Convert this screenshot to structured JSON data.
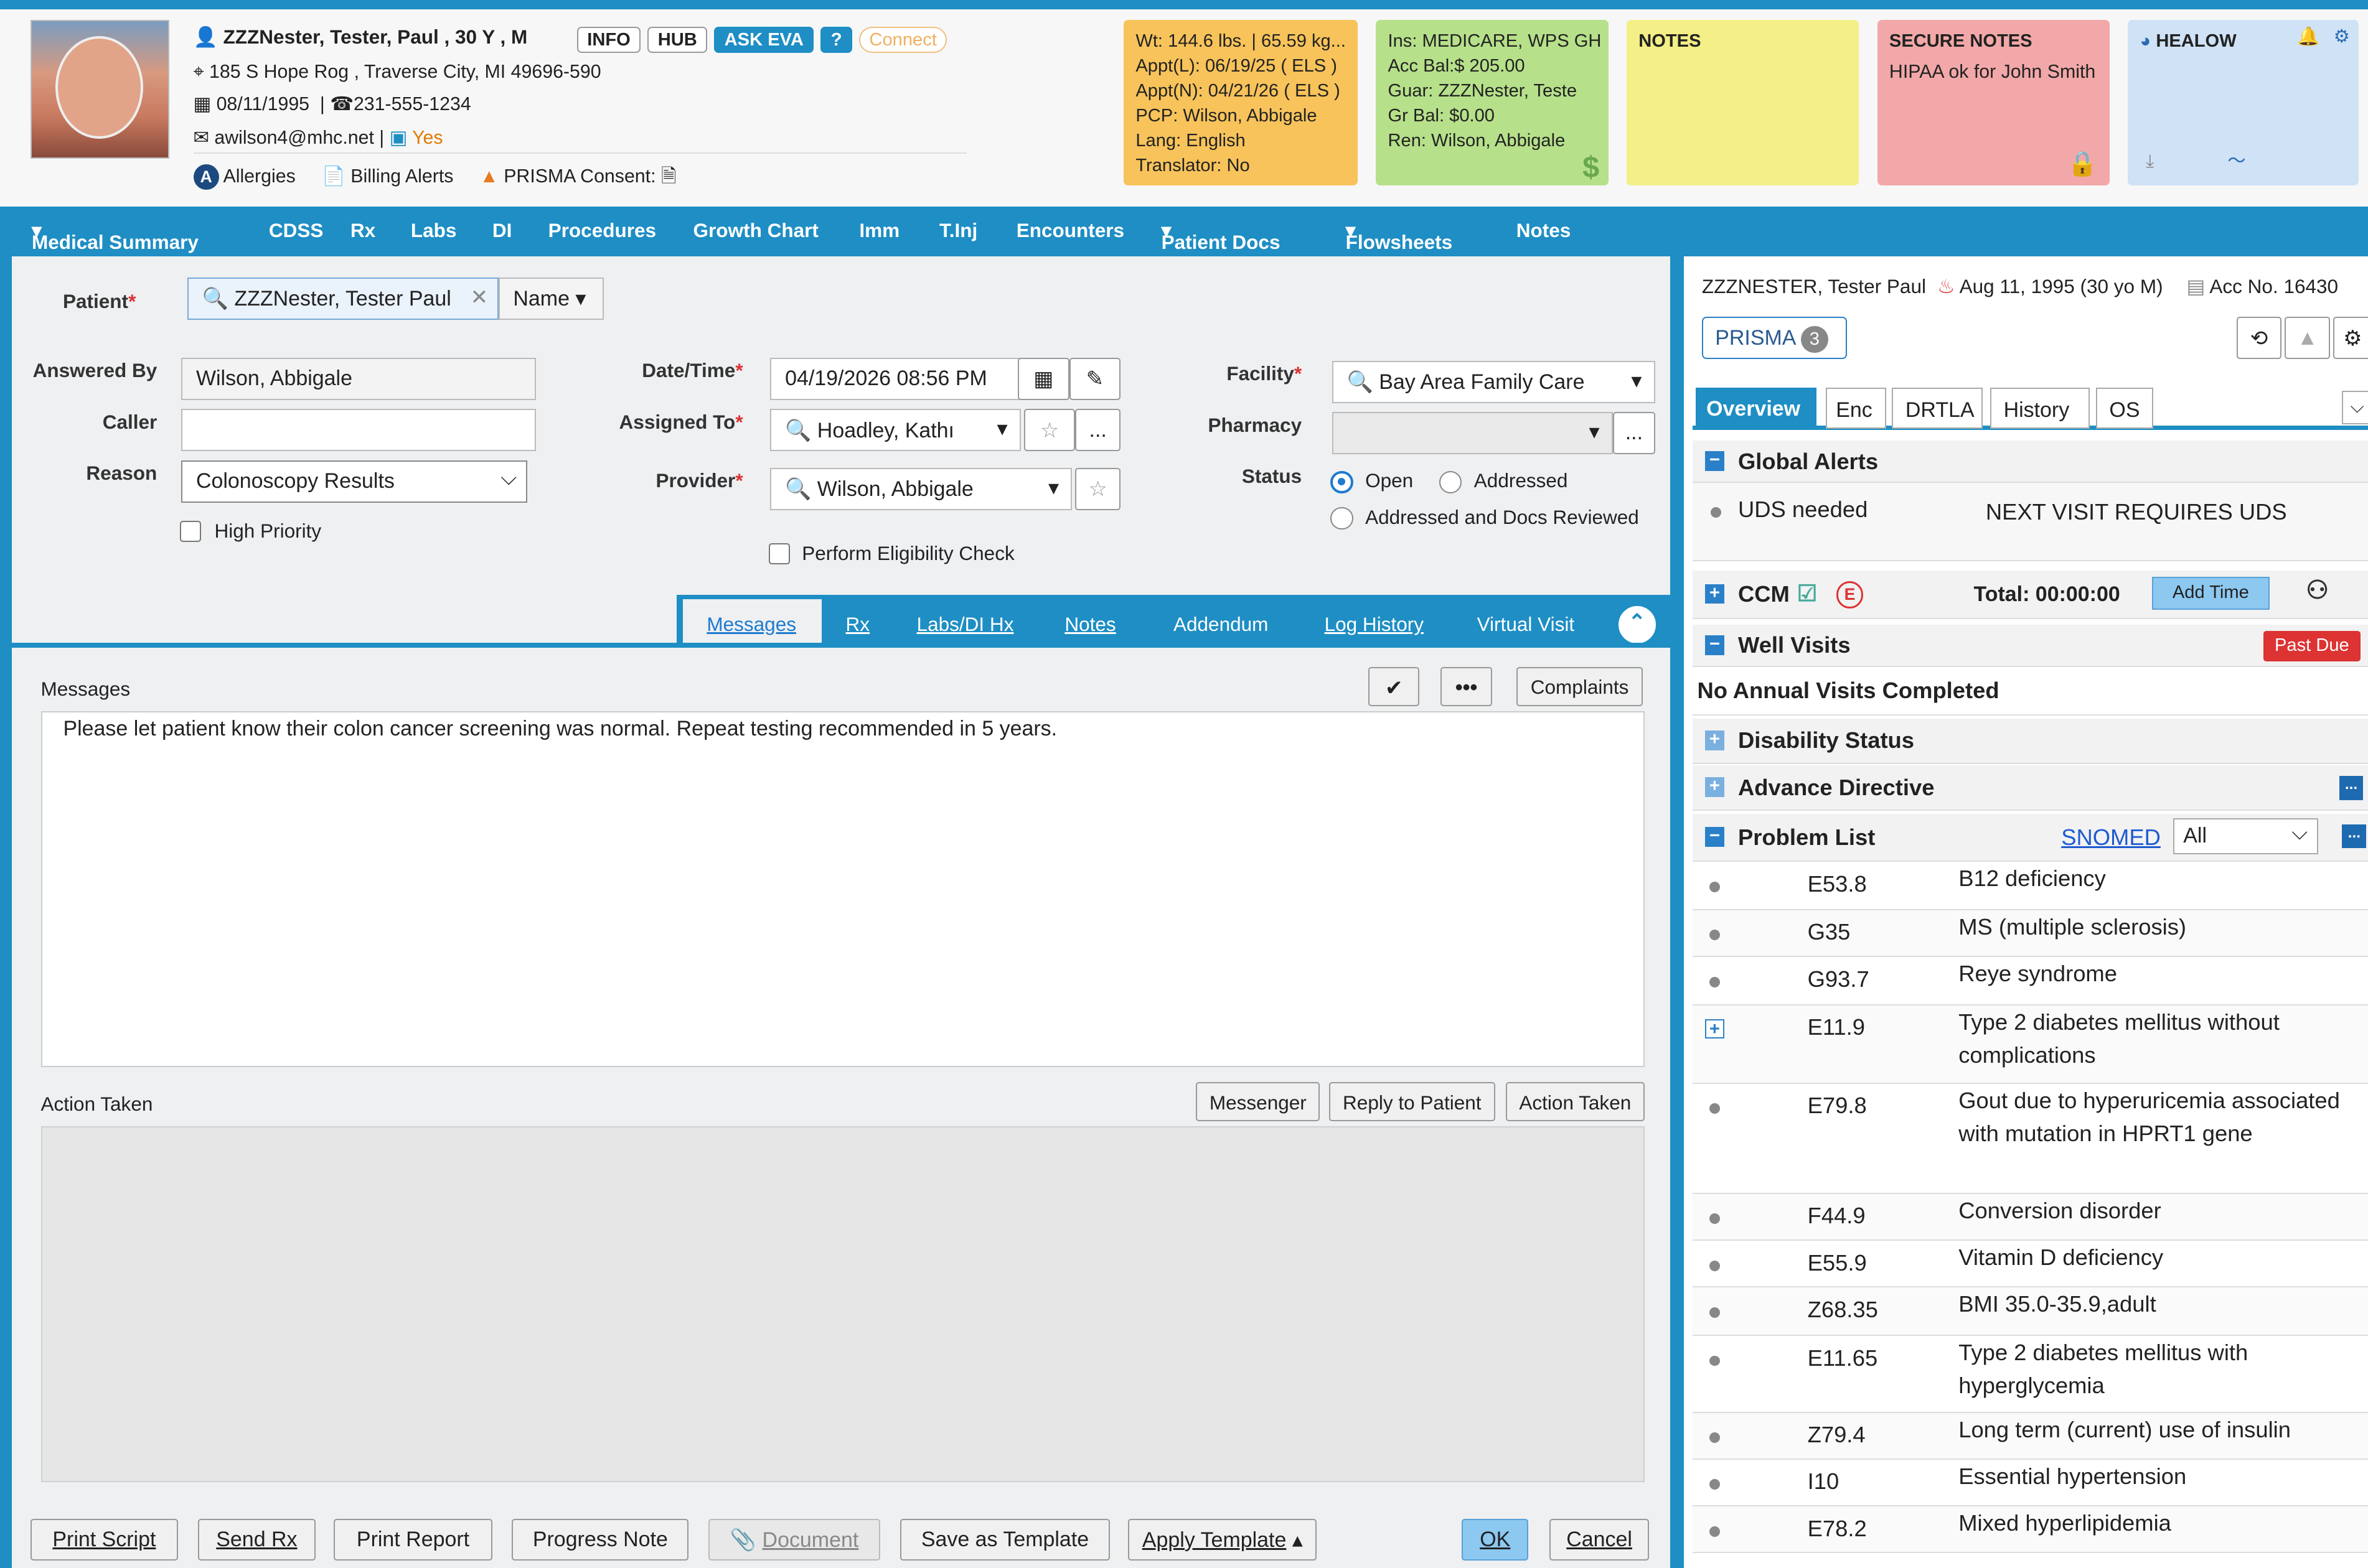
{
  "patient": {
    "name": "ZZZNester, Tester, Paul",
    "age_sex": ", 30 Y , M",
    "address": "185 S Hope Rog , Traverse City, MI 49696-590",
    "dob": "08/11/1995",
    "phone": "231-555-1234",
    "email": "awilson4@mhc.net",
    "email_flag": "Yes",
    "allergies": "Allergies",
    "billing_alerts": "Billing Alerts",
    "prisma_consent": "PRISMA Consent:"
  },
  "header_buttons": {
    "info": "INFO",
    "hub": "HUB",
    "ask_eva": "ASK EVA",
    "help": "?",
    "connect": "Connect"
  },
  "cards": {
    "vitals": [
      "Wt: 144.6 lbs. | 65.59 kg...",
      "Appt(L): 06/19/25 ( ELS )",
      "Appt(N): 04/21/26 ( ELS )",
      "PCP: Wilson, Abbigale",
      "Lang: English",
      "Translator: No"
    ],
    "insurance": [
      "Ins: MEDICARE, WPS GH",
      "Acc Bal:$ 205.00",
      "Guar: ZZZNester, Teste",
      "Gr Bal: $0.00",
      "Ren: Wilson, Abbigale"
    ],
    "notes_title": "NOTES",
    "secure_title": "SECURE NOTES",
    "secure_text": "HIPAA ok for John Smith",
    "healow_title": "HEALOW"
  },
  "nav": [
    "Medical Summary",
    "CDSS",
    "Rx",
    "Labs",
    "DI",
    "Procedures",
    "Growth Chart",
    "Imm",
    "T.Inj",
    "Encounters",
    "Patient Docs",
    "Flowsheets",
    "Notes"
  ],
  "form": {
    "patient_label": "Patient",
    "patient_value": "ZZZNester, Tester Paul",
    "name_dropdown": "Name",
    "answered_by_label": "Answered By",
    "answered_by": "Wilson, Abbigale",
    "caller_label": "Caller",
    "caller": "",
    "reason_label": "Reason",
    "reason": "Colonoscopy Results",
    "high_priority": "High Priority",
    "datetime_label": "Date/Time",
    "datetime": "04/19/2026 08:56 PM",
    "assigned_label": "Assigned To",
    "assigned": "Hoadley, Kathı",
    "provider_label": "Provider",
    "provider": "Wilson, Abbigale",
    "eligibility": "Perform Eligibility Check",
    "facility_label": "Facility",
    "facility": "Bay Area Family Care",
    "pharmacy_label": "Pharmacy",
    "pharmacy": "",
    "status_label": "Status",
    "status_open": "Open",
    "status_addressed": "Addressed",
    "status_reviewed": "Addressed and Docs Reviewed"
  },
  "tabs": [
    "Messages",
    "Rx",
    "Labs/DI Hx",
    "Notes",
    "Addendum",
    "Log History",
    "Virtual Visit"
  ],
  "messages": {
    "label": "Messages",
    "complaints": "Complaints",
    "more": "•••",
    "text": "Please let patient know their colon cancer screening was normal.  Repeat testing recommended in 5 years."
  },
  "action": {
    "label": "Action Taken",
    "messenger": "Messenger",
    "reply": "Reply to Patient",
    "action_taken": "Action Taken"
  },
  "footer": [
    "Print Script",
    "Send Rx",
    "Print Report",
    "Progress Note",
    "Document",
    "Save as Template",
    "Apply Template",
    "OK",
    "Cancel"
  ],
  "right": {
    "name": "ZZZNESTER, Tester Paul",
    "dob": "Aug 11, 1995 (30 yo M)",
    "acc": "Acc No. 16430",
    "prisma": "PRISMA",
    "prisma_count": "3",
    "tabs": [
      "Overview",
      "Enc",
      "DRTLA",
      "History",
      "OS"
    ],
    "global_alerts": "Global Alerts",
    "uds": "UDS needed",
    "uds_note": "NEXT VISIT REQUIRES UDS",
    "ccm": "CCM",
    "ccm_total": "Total: 00:00:00",
    "add_time": "Add Time",
    "ccm_e": "E",
    "well_visits": "Well Visits",
    "past_due": "Past Due",
    "no_annual": "No Annual Visits Completed",
    "disability": "Disability Status",
    "advance": "Advance Directive",
    "problem_list": "Problem List",
    "snomed": "SNOMED",
    "filter": "All",
    "problems": [
      {
        "code": "E53.8",
        "desc": "B12 deficiency"
      },
      {
        "code": "G35",
        "desc": "MS (multiple sclerosis)"
      },
      {
        "code": "G93.7",
        "desc": "Reye syndrome"
      },
      {
        "code": "E11.9",
        "desc": "Type 2 diabetes mellitus without complications"
      },
      {
        "code": "E79.8",
        "desc": "Gout due to hyperuricemia associated with mutation in HPRT1 gene"
      },
      {
        "code": "F44.9",
        "desc": "Conversion disorder"
      },
      {
        "code": "E55.9",
        "desc": "Vitamin D deficiency"
      },
      {
        "code": "Z68.35",
        "desc": "BMI 35.0-35.9,adult"
      },
      {
        "code": "E11.65",
        "desc": "Type 2 diabetes mellitus with hyperglycemia"
      },
      {
        "code": "Z79.4",
        "desc": "Long term (current) use of insulin"
      },
      {
        "code": "I10",
        "desc": "Essential hypertension"
      },
      {
        "code": "E78.2",
        "desc": "Mixed hyperlipidemia"
      }
    ]
  },
  "colors": {
    "primary": "#1e8ec4",
    "vitals": "#f7c35a",
    "insurance": "#b6e08a",
    "notes": "#f4ef86",
    "secure": "#f2a8a8",
    "healow": "#cfe2f6"
  }
}
